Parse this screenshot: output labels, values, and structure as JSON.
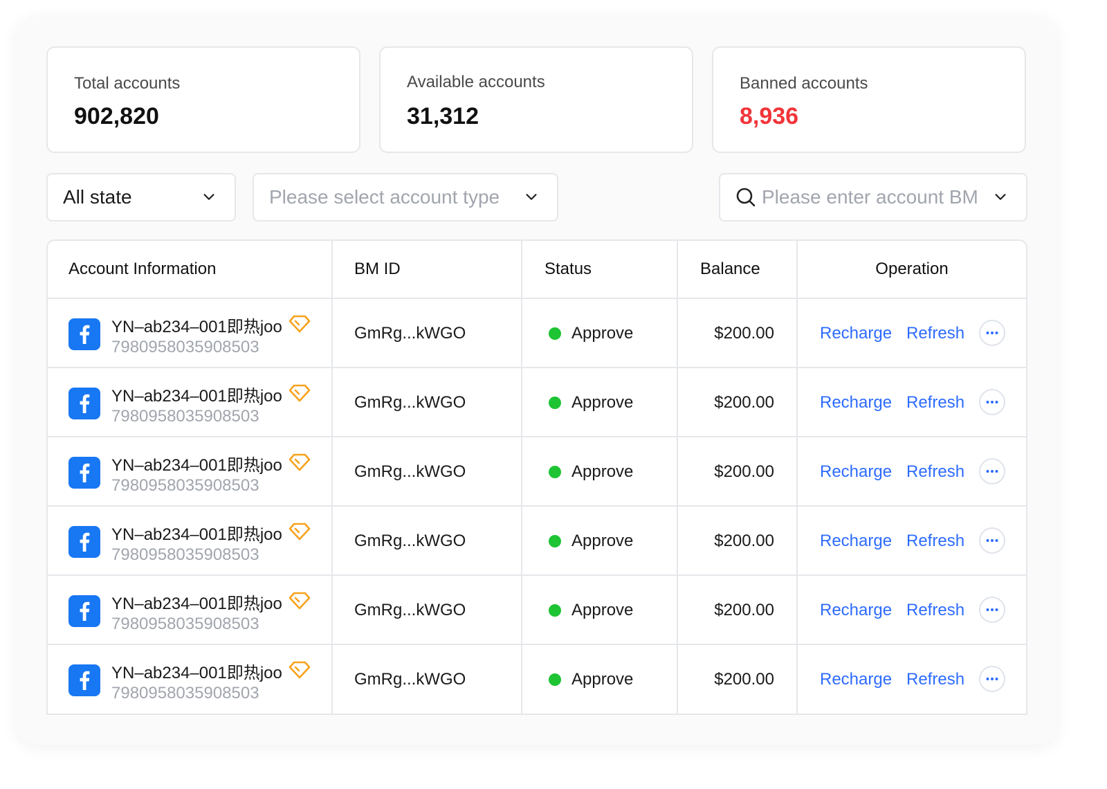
{
  "stats": [
    {
      "label": "Total accounts",
      "value": "902,820"
    },
    {
      "label": "Available accounts",
      "value": "31,312"
    },
    {
      "label": "Banned accounts",
      "value": "8,936",
      "color": "#f0353a"
    }
  ],
  "filters": {
    "state": {
      "value": "All state"
    },
    "account_type": {
      "placeholder": "Please select account type"
    },
    "search": {
      "placeholder": "Please enter account BM"
    }
  },
  "table": {
    "headers": {
      "account": "Account Information",
      "bm_id": "BM ID",
      "status": "Status",
      "balance": "Balance",
      "operation": "Operation"
    },
    "rows": [
      {
        "icon": "facebook-icon",
        "badge": "diamond-icon",
        "name": "YN–ab234–001即热joo",
        "id": "7980958035908503",
        "bm_id": "GmRg...kWGO",
        "status": "Approve",
        "balance": "$200.00",
        "recharge": "Recharge",
        "refresh": "Refresh"
      },
      {
        "icon": "facebook-icon",
        "badge": "diamond-icon",
        "name": "YN–ab234–001即热joo",
        "id": "7980958035908503",
        "bm_id": "GmRg...kWGO",
        "status": "Approve",
        "balance": "$200.00",
        "recharge": "Recharge",
        "refresh": "Refresh"
      },
      {
        "icon": "facebook-icon",
        "badge": "diamond-icon",
        "name": "YN–ab234–001即热joo",
        "id": "7980958035908503",
        "bm_id": "GmRg...kWGO",
        "status": "Approve",
        "balance": "$200.00",
        "recharge": "Recharge",
        "refresh": "Refresh"
      },
      {
        "icon": "facebook-icon",
        "badge": "diamond-icon",
        "name": "YN–ab234–001即热joo",
        "id": "7980958035908503",
        "bm_id": "GmRg...kWGO",
        "status": "Approve",
        "balance": "$200.00",
        "recharge": "Recharge",
        "refresh": "Refresh"
      },
      {
        "icon": "facebook-icon",
        "badge": "diamond-icon",
        "name": "YN–ab234–001即热joo",
        "id": "7980958035908503",
        "bm_id": "GmRg...kWGO",
        "status": "Approve",
        "balance": "$200.00",
        "recharge": "Recharge",
        "refresh": "Refresh"
      },
      {
        "icon": "facebook-icon",
        "badge": "diamond-icon",
        "name": "YN–ab234–001即热joo",
        "id": "7980958035908503",
        "bm_id": "GmRg...kWGO",
        "status": "Approve",
        "balance": "$200.00",
        "recharge": "Recharge",
        "refresh": "Refresh"
      }
    ]
  },
  "colors": {
    "accent": "#2d6bff",
    "facebook": "#1877f2",
    "status_approve": "#1ec433",
    "premium_badge": "#f7a21b",
    "danger": "#f0353a"
  }
}
